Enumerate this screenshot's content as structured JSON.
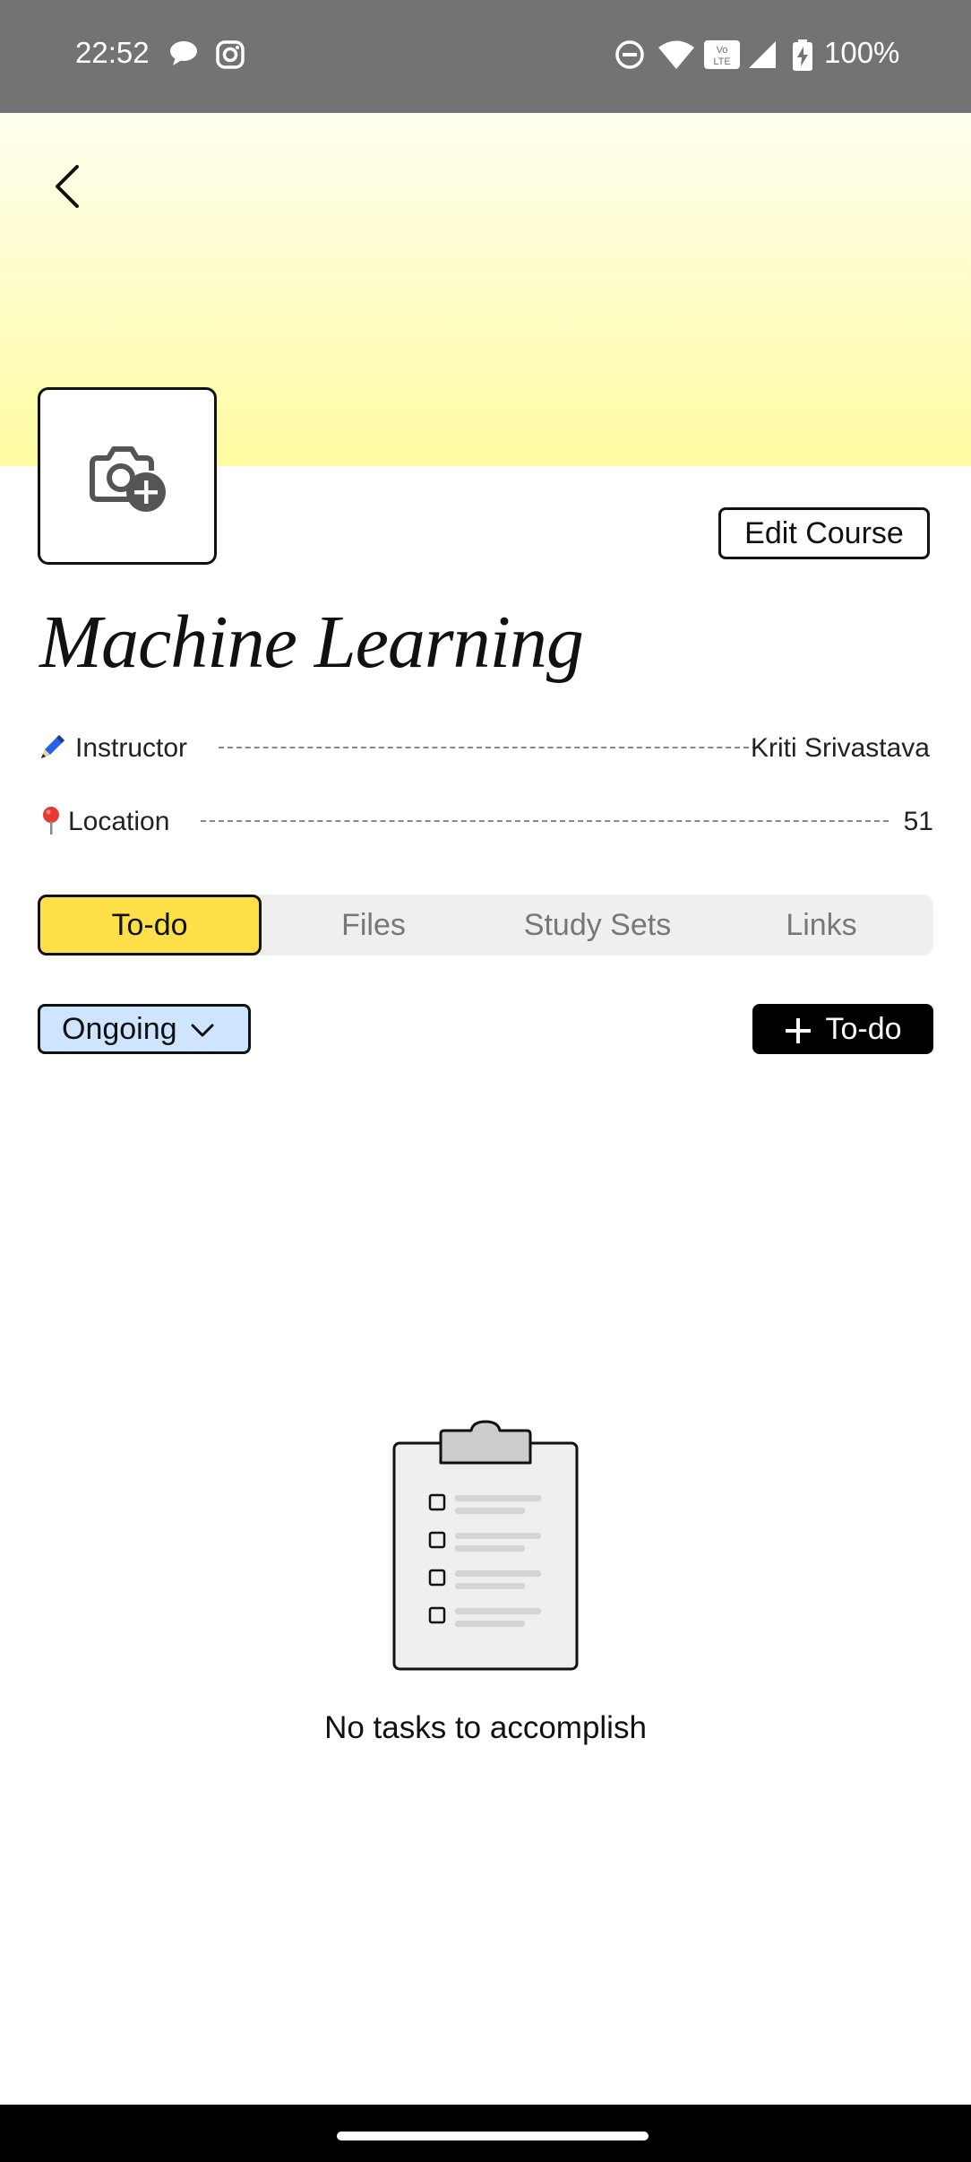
{
  "status_bar": {
    "time": "22:52",
    "battery": "100%",
    "icons": [
      "chat-icon",
      "instagram-icon",
      "dnd-icon",
      "wifi-icon",
      "volte-icon",
      "signal-icon",
      "battery-charging-icon"
    ]
  },
  "header": {
    "back_icon": "back-chevron-icon",
    "cover_icon": "camera-add-icon",
    "gradient_colors": [
      "#fffff0",
      "#fefba0"
    ]
  },
  "course": {
    "edit_label": "Edit Course",
    "title": "Machine Learning",
    "instructor_label": "Instructor",
    "instructor_value": "Kriti Srivastava",
    "instructor_icon": "pen-icon",
    "location_label": "Location",
    "location_value": "51",
    "location_icon": "pin-icon"
  },
  "tabs": [
    {
      "label": "To-do",
      "active": true
    },
    {
      "label": "Files",
      "active": false
    },
    {
      "label": "Study Sets",
      "active": false
    },
    {
      "label": "Links",
      "active": false
    }
  ],
  "filter": {
    "label": "Ongoing",
    "color": "#cfe5ff"
  },
  "add_todo": {
    "label": "To-do"
  },
  "empty_state": {
    "icon": "clipboard-icon",
    "text": "No tasks to accomplish"
  },
  "accent_color": "#fde047"
}
